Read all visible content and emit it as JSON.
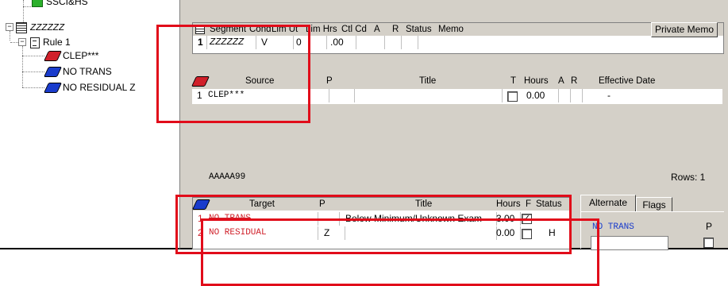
{
  "tree": {
    "items": [
      {
        "label": "SSCI&HS"
      },
      {
        "label": "ZZZZZZ"
      },
      {
        "label": "Rule 1"
      },
      {
        "label": "CLEP***"
      },
      {
        "label": "NO TRANS"
      },
      {
        "label": "NO RESIDUAL Z"
      }
    ]
  },
  "segment": {
    "headers": [
      "Segment",
      "Cond",
      "Lim Ut",
      "Lim Hrs",
      "Ctl Cd",
      "A",
      "R",
      "Status",
      "Memo"
    ],
    "private_memo_label": "Private Memo",
    "row": {
      "num": "1",
      "segment": "ZZZZZZ",
      "cond": "V",
      "lim_ut": "0",
      "lim_hrs": ".00"
    }
  },
  "source": {
    "headers": [
      "Source",
      "P",
      "Title",
      "T",
      "Hours",
      "A",
      "R",
      "Effective Date"
    ],
    "row": {
      "num": "1",
      "source": "CLEP***",
      "hours": "0.00",
      "effective_date": "-"
    },
    "footer_code": "AAAAA99",
    "rows_label": "Rows: 1"
  },
  "target": {
    "headers": [
      "Target",
      "P",
      "Title",
      "Hours",
      "F",
      "Status"
    ],
    "rows": [
      {
        "num": "1",
        "target": "NO TRANS",
        "p": "",
        "title": "Below Minimum/Unknown Exam",
        "hours": "3.00",
        "checked": true,
        "status": ""
      },
      {
        "num": "2",
        "target": "NO RESIDUAL",
        "p": "Z",
        "title": "",
        "hours": "0.00",
        "checked": false,
        "status": "H"
      }
    ]
  },
  "side": {
    "tabs": [
      "Alternate",
      "Flags"
    ],
    "value": "NO TRANS",
    "p_label": "P"
  },
  "colors": {
    "highlight": "#e10c1a",
    "target_text": "#d0202a",
    "alt_text": "#1a3ccc"
  }
}
